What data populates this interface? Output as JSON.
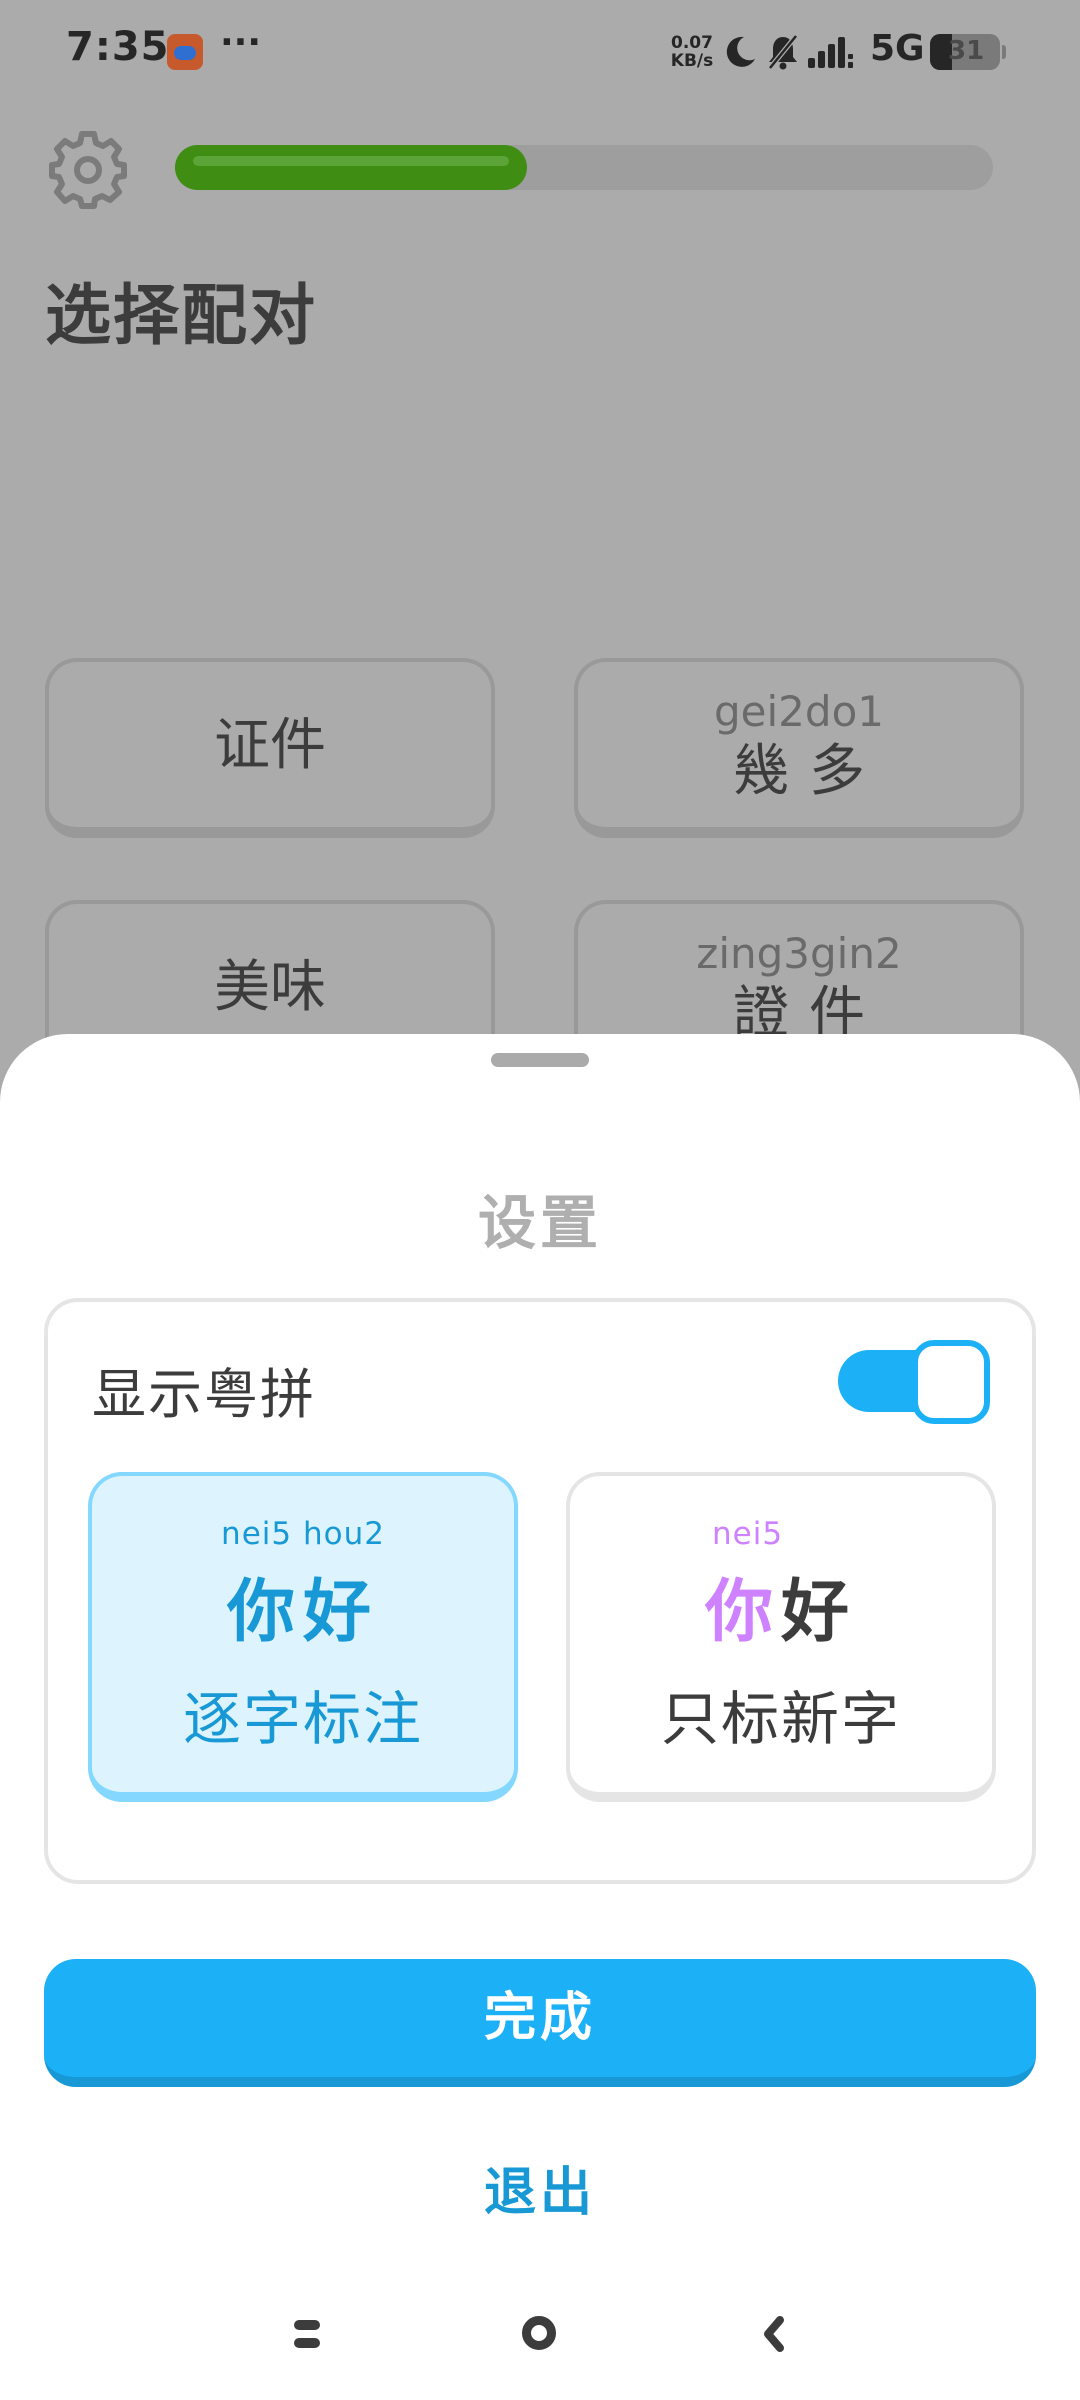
{
  "status_bar": {
    "time": "7:35",
    "more": "···",
    "net_speed_value": "0.07",
    "net_speed_unit": "KB/s",
    "network": "5G",
    "battery": "31",
    "icons": [
      "app-notification-icon",
      "moon-icon",
      "bell-muted-icon",
      "signal-icon",
      "battery-icon"
    ]
  },
  "lesson": {
    "title": "选择配对",
    "progress_fraction": 0.43,
    "progress_color": "#3f8d13"
  },
  "cards": {
    "left_1": "证件",
    "right_1_romanization": "gei2do1",
    "right_1_chars": "幾多",
    "left_2": "美味",
    "right_2_romanization": "zing3gin2",
    "right_2_chars": "證件"
  },
  "sheet": {
    "title": "设置",
    "setting_label": "显示粤拼",
    "toggle_on": true,
    "option_all": {
      "romanization": "nei5 hou2",
      "char_1": "你",
      "char_2": "好",
      "label": "逐字标注"
    },
    "option_new": {
      "romanization": "nei5",
      "char_1": "你",
      "char_2": "好",
      "label": "只标新字"
    },
    "done_button": "完成",
    "exit_link": "退出"
  },
  "colors": {
    "accent": "#1cb0f6",
    "accent_dark": "#1899d6",
    "new_char": "#ce82ff"
  }
}
